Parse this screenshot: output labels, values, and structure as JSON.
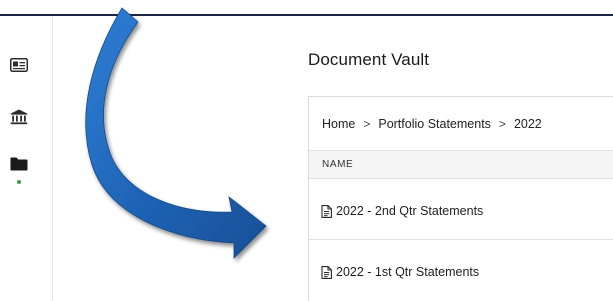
{
  "sidebar": {
    "items": [
      {
        "icon": "id-card-icon",
        "active": false
      },
      {
        "icon": "bank-icon",
        "active": false
      },
      {
        "icon": "folder-icon",
        "active": true
      }
    ],
    "active_indicator_color": "#3aa043"
  },
  "main": {
    "title": "Document Vault",
    "breadcrumb": [
      "Home",
      "Portfolio Statements",
      "2022"
    ],
    "breadcrumb_separator": ">",
    "table": {
      "columns": [
        "NAME"
      ],
      "rows": [
        {
          "icon": "document-icon",
          "name": "2022 - 2nd Qtr Statements"
        },
        {
          "icon": "document-icon",
          "name": "2022 - 1st Qtr Statements"
        }
      ]
    }
  },
  "colors": {
    "header_bar": "#1b2645",
    "arrow_fill": "#1e63b5",
    "text": "#1f1f1f"
  }
}
